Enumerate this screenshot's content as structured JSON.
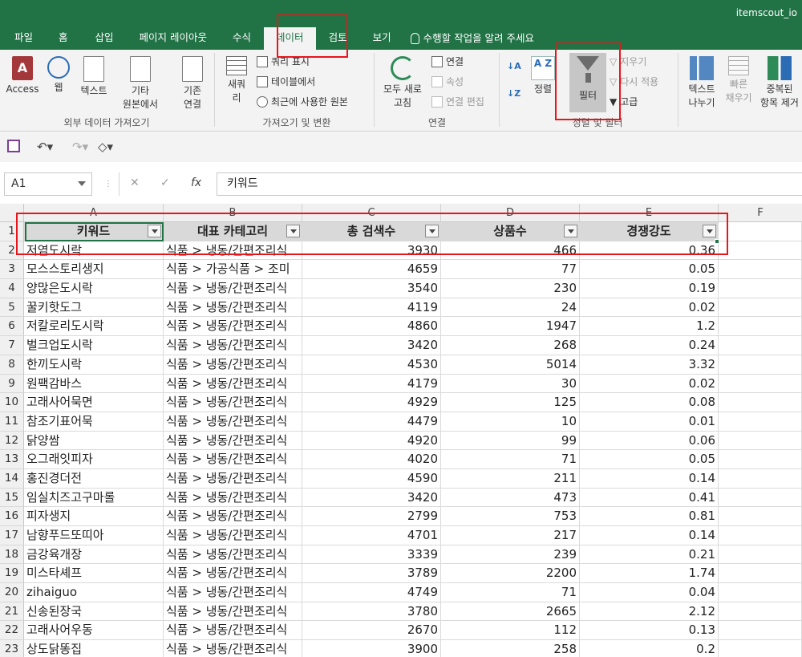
{
  "window": {
    "title_right": "itemscout_io"
  },
  "tabs": [
    "파일",
    "홈",
    "삽입",
    "페이지 레이아웃",
    "수식",
    "데이터",
    "검토",
    "보기"
  ],
  "tell_me": "수행할 작업을 알려 주세요",
  "ribbon": {
    "external": {
      "access": "Access",
      "web": "웹",
      "text": "텍스트",
      "other_line1": "기타",
      "other_line2": "원본에서",
      "existing_line1": "기존",
      "existing_line2": "연결",
      "group_label": "외부 데이터 가져오기"
    },
    "transform": {
      "new_line1": "새쿼",
      "new_line2": "리",
      "show_query": "쿼리 표시",
      "from_table": "테이블에서",
      "recent_sources": "최근에 사용한 원본",
      "group_label": "가져오기 및 변환"
    },
    "connections": {
      "refresh_line1": "모두 새로",
      "refresh_line2": "고침",
      "connections": "연결",
      "properties": "속성",
      "edit_links": "연결 편집",
      "group_label": "연결"
    },
    "sort_filter": {
      "sort": "정렬",
      "filter": "필터",
      "clear": "지우기",
      "reapply": "다시 적용",
      "advanced": "고급",
      "group_label": "정렬 및 필터"
    },
    "data_tools": {
      "text_to_columns_line1": "텍스트",
      "text_to_columns_line2": "나누기",
      "flash_fill_line1": "빠른",
      "flash_fill_line2": "채우기",
      "remove_dup_line1": "중복된",
      "remove_dup_line2": "항목 제거"
    }
  },
  "formula_bar": {
    "name_box": "A1",
    "fx": "fx",
    "value": "키워드"
  },
  "sheet": {
    "columns": [
      "A",
      "B",
      "C",
      "D",
      "E",
      "F"
    ],
    "headers": [
      "키워드",
      "대표 카테고리",
      "총 검색수",
      "상품수",
      "경쟁강도"
    ],
    "rows": [
      [
        "저염도시락",
        "식품 > 냉동/간편조리식",
        "3930",
        "466",
        "0.36"
      ],
      [
        "모스스토리생지",
        "식품 > 가공식품 > 조미",
        "4659",
        "77",
        "0.05"
      ],
      [
        "양많은도시락",
        "식품 > 냉동/간편조리식",
        "3540",
        "230",
        "0.19"
      ],
      [
        "꿀키핫도그",
        "식품 > 냉동/간편조리식",
        "4119",
        "24",
        "0.02"
      ],
      [
        "저칼로리도시락",
        "식품 > 냉동/간편조리식",
        "4860",
        "1947",
        "1.2"
      ],
      [
        "벌크업도시락",
        "식품 > 냉동/간편조리식",
        "3420",
        "268",
        "0.24"
      ],
      [
        "한끼도시락",
        "식품 > 냉동/간편조리식",
        "4530",
        "5014",
        "3.32"
      ],
      [
        "원팩감바스",
        "식품 > 냉동/간편조리식",
        "4179",
        "30",
        "0.02"
      ],
      [
        "고래사어묵면",
        "식품 > 냉동/간편조리식",
        "4929",
        "125",
        "0.08"
      ],
      [
        "참조기표어묵",
        "식품 > 냉동/간편조리식",
        "4479",
        "10",
        "0.01"
      ],
      [
        "닭양쌈",
        "식품 > 냉동/간편조리식",
        "4920",
        "99",
        "0.06"
      ],
      [
        "오그래잇피자",
        "식품 > 냉동/간편조리식",
        "4020",
        "71",
        "0.05"
      ],
      [
        "홍진경더전",
        "식품 > 냉동/간편조리식",
        "4590",
        "211",
        "0.14"
      ],
      [
        "임실치즈고구마롤",
        "식품 > 냉동/간편조리식",
        "3420",
        "473",
        "0.41"
      ],
      [
        "피자생지",
        "식품 > 냉동/간편조리식",
        "2799",
        "753",
        "0.81"
      ],
      [
        "남향푸드또띠아",
        "식품 > 냉동/간편조리식",
        "4701",
        "217",
        "0.14"
      ],
      [
        "금강육개장",
        "식품 > 냉동/간편조리식",
        "3339",
        "239",
        "0.21"
      ],
      [
        "미스타셰프",
        "식품 > 냉동/간편조리식",
        "3789",
        "2200",
        "1.74"
      ],
      [
        "zihaiguo",
        "식품 > 냉동/간편조리식",
        "4749",
        "71",
        "0.04"
      ],
      [
        "신송된장국",
        "식품 > 냉동/간편조리식",
        "3780",
        "2665",
        "2.12"
      ],
      [
        "고래사어우동",
        "식품 > 냉동/간편조리식",
        "2670",
        "112",
        "0.13"
      ],
      [
        "상도닭똥집",
        "식품 > 냉동/간편조리식",
        "3900",
        "258",
        "0.2"
      ]
    ]
  },
  "colors": {
    "excel_green": "#217346",
    "annotation_red": "#e8151b"
  }
}
